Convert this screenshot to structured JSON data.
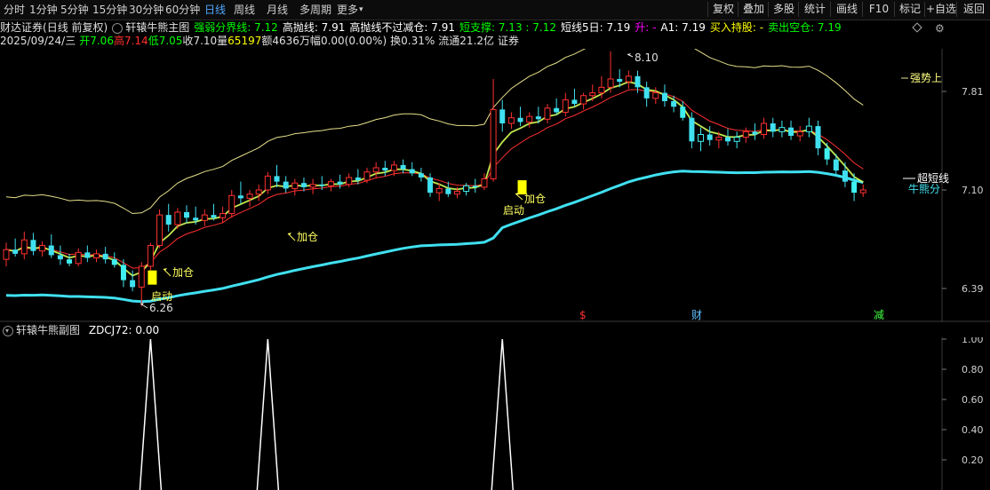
{
  "toolbar": {
    "periods": [
      "分时",
      "1分钟",
      "5分钟",
      "15分钟",
      "30分钟",
      "60分钟",
      "日线",
      "周线",
      "月线",
      "多周期",
      "更多"
    ],
    "active_period": "日线",
    "more_arrow": "▾",
    "right_buttons": [
      "复权",
      "叠加",
      "多股",
      "统计",
      "画线",
      "F10",
      "标记",
      "+自选",
      "返回"
    ]
  },
  "info_line1": {
    "stock": "财达证券",
    "stock_mode": "(日线 前复权)",
    "indicator_icon": "circle-arrow-icon",
    "indicator_name": "轩辕牛熊主图",
    "items": [
      {
        "label": "强弱分界线:",
        "value": "7.12",
        "color": "#00ff00"
      },
      {
        "label": "高抛线:",
        "value": "7.91",
        "color": "#ffffff"
      },
      {
        "label": "高抛线不过减仓:",
        "value": "7.91",
        "color": "#ffffff"
      },
      {
        "label": "短支撑:",
        "value": "7.13 : 7.12",
        "color": "#00ff00"
      },
      {
        "label": "短线5日:",
        "value": "7.19",
        "color": "#ffffff"
      },
      {
        "label": "升:",
        "value": "-",
        "color": "#ff00ff"
      },
      {
        "label": "A1:",
        "value": "7.19",
        "color": "#ffffff"
      },
      {
        "label": "买入持股:",
        "value": "-",
        "color": "#ffff00"
      },
      {
        "label": "卖出空仓:",
        "value": "7.19",
        "color": "#00ff00"
      }
    ],
    "diamond_icon": "diamond-icon",
    "gear_icon": "gear-icon"
  },
  "info_line2": {
    "date": "2025/09/24/三",
    "open_label": "开",
    "open": "7.06",
    "high_label": "高",
    "high": "7.14",
    "low_label": "低",
    "low": "7.05",
    "close_label": "收",
    "close": "7.10",
    "volume_label": "量",
    "volume": "65197",
    "amount_label": "额",
    "amount": "4636万",
    "range_label": "幅",
    "range": "0.00(0.00%)",
    "turnover_label": "换",
    "turnover": "0.31%",
    "float_label": "流通",
    "float": "21.2亿",
    "sector": "证券"
  },
  "main_chart": {
    "y_ticks": [
      "7.81",
      "7.10",
      "6.39"
    ],
    "annotations": {
      "high_value": "8.10",
      "low_value": "6.26",
      "add1": "加仓",
      "add2": "加仓",
      "add3": "加仓",
      "start1": "启动",
      "start2": "启动",
      "strong_upper": "强势上",
      "super_short": "超短线",
      "bull_bear": "牛熊分"
    },
    "event_marks": [
      {
        "label": "$",
        "color": "#ff3030"
      },
      {
        "label": "财",
        "color": "#60c0ff"
      },
      {
        "label": "减",
        "color": "#40ff40"
      }
    ]
  },
  "chart_data": {
    "type": "candlestick",
    "y_range": [
      6.2,
      8.25
    ],
    "x_count": 100,
    "candles": [
      {
        "o": 6.6,
        "h": 6.72,
        "l": 6.55,
        "c": 6.67
      },
      {
        "o": 6.67,
        "h": 6.75,
        "l": 6.62,
        "c": 6.64
      },
      {
        "o": 6.64,
        "h": 6.8,
        "l": 6.6,
        "c": 6.74
      },
      {
        "o": 6.74,
        "h": 6.79,
        "l": 6.63,
        "c": 6.66
      },
      {
        "o": 6.66,
        "h": 6.73,
        "l": 6.62,
        "c": 6.7
      },
      {
        "o": 6.7,
        "h": 6.78,
        "l": 6.61,
        "c": 6.63
      },
      {
        "o": 6.63,
        "h": 6.7,
        "l": 6.56,
        "c": 6.6
      },
      {
        "o": 6.6,
        "h": 6.64,
        "l": 6.55,
        "c": 6.57
      },
      {
        "o": 6.57,
        "h": 6.68,
        "l": 6.55,
        "c": 6.65
      },
      {
        "o": 6.65,
        "h": 6.7,
        "l": 6.58,
        "c": 6.61
      },
      {
        "o": 6.61,
        "h": 6.67,
        "l": 6.58,
        "c": 6.64
      },
      {
        "o": 6.64,
        "h": 6.69,
        "l": 6.57,
        "c": 6.6
      },
      {
        "o": 6.6,
        "h": 6.65,
        "l": 6.54,
        "c": 6.56
      },
      {
        "o": 6.56,
        "h": 6.6,
        "l": 6.4,
        "c": 6.45
      },
      {
        "o": 6.45,
        "h": 6.52,
        "l": 6.37,
        "c": 6.4
      },
      {
        "o": 6.4,
        "h": 6.58,
        "l": 6.26,
        "c": 6.55
      },
      {
        "o": 6.55,
        "h": 6.72,
        "l": 6.52,
        "c": 6.7
      },
      {
        "o": 6.7,
        "h": 6.96,
        "l": 6.68,
        "c": 6.92
      },
      {
        "o": 6.92,
        "h": 7.0,
        "l": 6.8,
        "c": 6.85
      },
      {
        "o": 6.85,
        "h": 6.97,
        "l": 6.82,
        "c": 6.94
      },
      {
        "o": 6.94,
        "h": 6.99,
        "l": 6.86,
        "c": 6.9
      },
      {
        "o": 6.9,
        "h": 6.98,
        "l": 6.85,
        "c": 6.88
      },
      {
        "o": 6.88,
        "h": 6.96,
        "l": 6.84,
        "c": 6.92
      },
      {
        "o": 6.92,
        "h": 7.0,
        "l": 6.88,
        "c": 6.9
      },
      {
        "o": 6.9,
        "h": 6.98,
        "l": 6.86,
        "c": 6.93
      },
      {
        "o": 6.93,
        "h": 7.1,
        "l": 6.9,
        "c": 7.06
      },
      {
        "o": 7.06,
        "h": 7.16,
        "l": 7.0,
        "c": 7.04
      },
      {
        "o": 7.04,
        "h": 7.1,
        "l": 6.98,
        "c": 7.07
      },
      {
        "o": 7.07,
        "h": 7.14,
        "l": 7.02,
        "c": 7.1
      },
      {
        "o": 7.1,
        "h": 7.23,
        "l": 7.07,
        "c": 7.2
      },
      {
        "o": 7.2,
        "h": 7.28,
        "l": 7.12,
        "c": 7.16
      },
      {
        "o": 7.16,
        "h": 7.2,
        "l": 7.08,
        "c": 7.11
      },
      {
        "o": 7.11,
        "h": 7.18,
        "l": 7.06,
        "c": 7.15
      },
      {
        "o": 7.15,
        "h": 7.19,
        "l": 7.09,
        "c": 7.12
      },
      {
        "o": 7.12,
        "h": 7.18,
        "l": 7.07,
        "c": 7.14
      },
      {
        "o": 7.14,
        "h": 7.2,
        "l": 7.1,
        "c": 7.13
      },
      {
        "o": 7.13,
        "h": 7.18,
        "l": 7.09,
        "c": 7.16
      },
      {
        "o": 7.16,
        "h": 7.21,
        "l": 7.11,
        "c": 7.14
      },
      {
        "o": 7.14,
        "h": 7.22,
        "l": 7.12,
        "c": 7.19
      },
      {
        "o": 7.19,
        "h": 7.25,
        "l": 7.14,
        "c": 7.17
      },
      {
        "o": 7.17,
        "h": 7.26,
        "l": 7.15,
        "c": 7.23
      },
      {
        "o": 7.23,
        "h": 7.3,
        "l": 7.19,
        "c": 7.26
      },
      {
        "o": 7.26,
        "h": 7.31,
        "l": 7.2,
        "c": 7.24
      },
      {
        "o": 7.24,
        "h": 7.31,
        "l": 7.2,
        "c": 7.28
      },
      {
        "o": 7.28,
        "h": 7.32,
        "l": 7.22,
        "c": 7.25
      },
      {
        "o": 7.25,
        "h": 7.3,
        "l": 7.2,
        "c": 7.22
      },
      {
        "o": 7.22,
        "h": 7.26,
        "l": 7.16,
        "c": 7.19
      },
      {
        "o": 7.19,
        "h": 7.22,
        "l": 7.05,
        "c": 7.08
      },
      {
        "o": 7.08,
        "h": 7.15,
        "l": 7.02,
        "c": 7.11
      },
      {
        "o": 7.11,
        "h": 7.16,
        "l": 7.05,
        "c": 7.07
      },
      {
        "o": 7.07,
        "h": 7.12,
        "l": 7.04,
        "c": 7.09
      },
      {
        "o": 7.09,
        "h": 7.15,
        "l": 7.06,
        "c": 7.13
      },
      {
        "o": 7.13,
        "h": 7.18,
        "l": 7.08,
        "c": 7.12
      },
      {
        "o": 7.12,
        "h": 7.22,
        "l": 7.1,
        "c": 7.18
      },
      {
        "o": 7.18,
        "h": 7.9,
        "l": 7.16,
        "c": 7.68
      },
      {
        "o": 7.68,
        "h": 7.75,
        "l": 7.52,
        "c": 7.58
      },
      {
        "o": 7.58,
        "h": 7.66,
        "l": 7.54,
        "c": 7.62
      },
      {
        "o": 7.62,
        "h": 7.7,
        "l": 7.56,
        "c": 7.59
      },
      {
        "o": 7.59,
        "h": 7.66,
        "l": 7.55,
        "c": 7.63
      },
      {
        "o": 7.63,
        "h": 7.7,
        "l": 7.58,
        "c": 7.61
      },
      {
        "o": 7.61,
        "h": 7.72,
        "l": 7.58,
        "c": 7.69
      },
      {
        "o": 7.69,
        "h": 7.76,
        "l": 7.64,
        "c": 7.66
      },
      {
        "o": 7.66,
        "h": 7.8,
        "l": 7.63,
        "c": 7.75
      },
      {
        "o": 7.75,
        "h": 7.83,
        "l": 7.7,
        "c": 7.72
      },
      {
        "o": 7.72,
        "h": 7.8,
        "l": 7.68,
        "c": 7.78
      },
      {
        "o": 7.78,
        "h": 7.86,
        "l": 7.74,
        "c": 7.8
      },
      {
        "o": 7.8,
        "h": 7.92,
        "l": 7.76,
        "c": 7.84
      },
      {
        "o": 7.84,
        "h": 8.1,
        "l": 7.8,
        "c": 7.9
      },
      {
        "o": 7.9,
        "h": 7.97,
        "l": 7.84,
        "c": 7.88
      },
      {
        "o": 7.88,
        "h": 7.96,
        "l": 7.83,
        "c": 7.92
      },
      {
        "o": 7.92,
        "h": 7.96,
        "l": 7.8,
        "c": 7.84
      },
      {
        "o": 7.84,
        "h": 7.88,
        "l": 7.7,
        "c": 7.76
      },
      {
        "o": 7.76,
        "h": 7.84,
        "l": 7.72,
        "c": 7.8
      },
      {
        "o": 7.8,
        "h": 7.86,
        "l": 7.7,
        "c": 7.74
      },
      {
        "o": 7.74,
        "h": 7.78,
        "l": 7.66,
        "c": 7.7
      },
      {
        "o": 7.7,
        "h": 7.74,
        "l": 7.6,
        "c": 7.62
      },
      {
        "o": 7.62,
        "h": 7.66,
        "l": 7.4,
        "c": 7.45
      },
      {
        "o": 7.45,
        "h": 7.55,
        "l": 7.38,
        "c": 7.5
      },
      {
        "o": 7.5,
        "h": 7.56,
        "l": 7.42,
        "c": 7.46
      },
      {
        "o": 7.46,
        "h": 7.52,
        "l": 7.4,
        "c": 7.48
      },
      {
        "o": 7.48,
        "h": 7.54,
        "l": 7.42,
        "c": 7.45
      },
      {
        "o": 7.45,
        "h": 7.52,
        "l": 7.4,
        "c": 7.48
      },
      {
        "o": 7.48,
        "h": 7.55,
        "l": 7.44,
        "c": 7.52
      },
      {
        "o": 7.52,
        "h": 7.58,
        "l": 7.46,
        "c": 7.5
      },
      {
        "o": 7.5,
        "h": 7.62,
        "l": 7.47,
        "c": 7.58
      },
      {
        "o": 7.58,
        "h": 7.62,
        "l": 7.48,
        "c": 7.52
      },
      {
        "o": 7.52,
        "h": 7.6,
        "l": 7.48,
        "c": 7.55
      },
      {
        "o": 7.55,
        "h": 7.6,
        "l": 7.46,
        "c": 7.49
      },
      {
        "o": 7.49,
        "h": 7.56,
        "l": 7.45,
        "c": 7.52
      },
      {
        "o": 7.52,
        "h": 7.62,
        "l": 7.48,
        "c": 7.56
      },
      {
        "o": 7.56,
        "h": 7.6,
        "l": 7.35,
        "c": 7.4
      },
      {
        "o": 7.4,
        "h": 7.44,
        "l": 7.28,
        "c": 7.32
      },
      {
        "o": 7.32,
        "h": 7.36,
        "l": 7.2,
        "c": 7.24
      },
      {
        "o": 7.24,
        "h": 7.3,
        "l": 7.12,
        "c": 7.16
      },
      {
        "o": 7.16,
        "h": 7.22,
        "l": 7.02,
        "c": 7.08
      },
      {
        "o": 7.08,
        "h": 7.14,
        "l": 7.05,
        "c": 7.1
      }
    ],
    "lines": [
      {
        "name": "强势上",
        "color": "#ffff80"
      },
      {
        "name": "超短线",
        "color": "#ffffff"
      },
      {
        "name": "牛熊分",
        "color": "#40e0f0"
      }
    ]
  },
  "sub_chart": {
    "indicator_icon": "circle-arrow-icon",
    "name": "轩辕牛熊副图",
    "value_label": "ZDCJ72:",
    "value": "0.00",
    "y_ticks": [
      "1.00",
      "0.80",
      "0.60",
      "0.40",
      "0.20"
    ],
    "spikes": [
      {
        "index": 16,
        "value": 1.0
      },
      {
        "index": 29,
        "value": 1.0
      },
      {
        "index": 55,
        "value": 1.0
      }
    ]
  }
}
